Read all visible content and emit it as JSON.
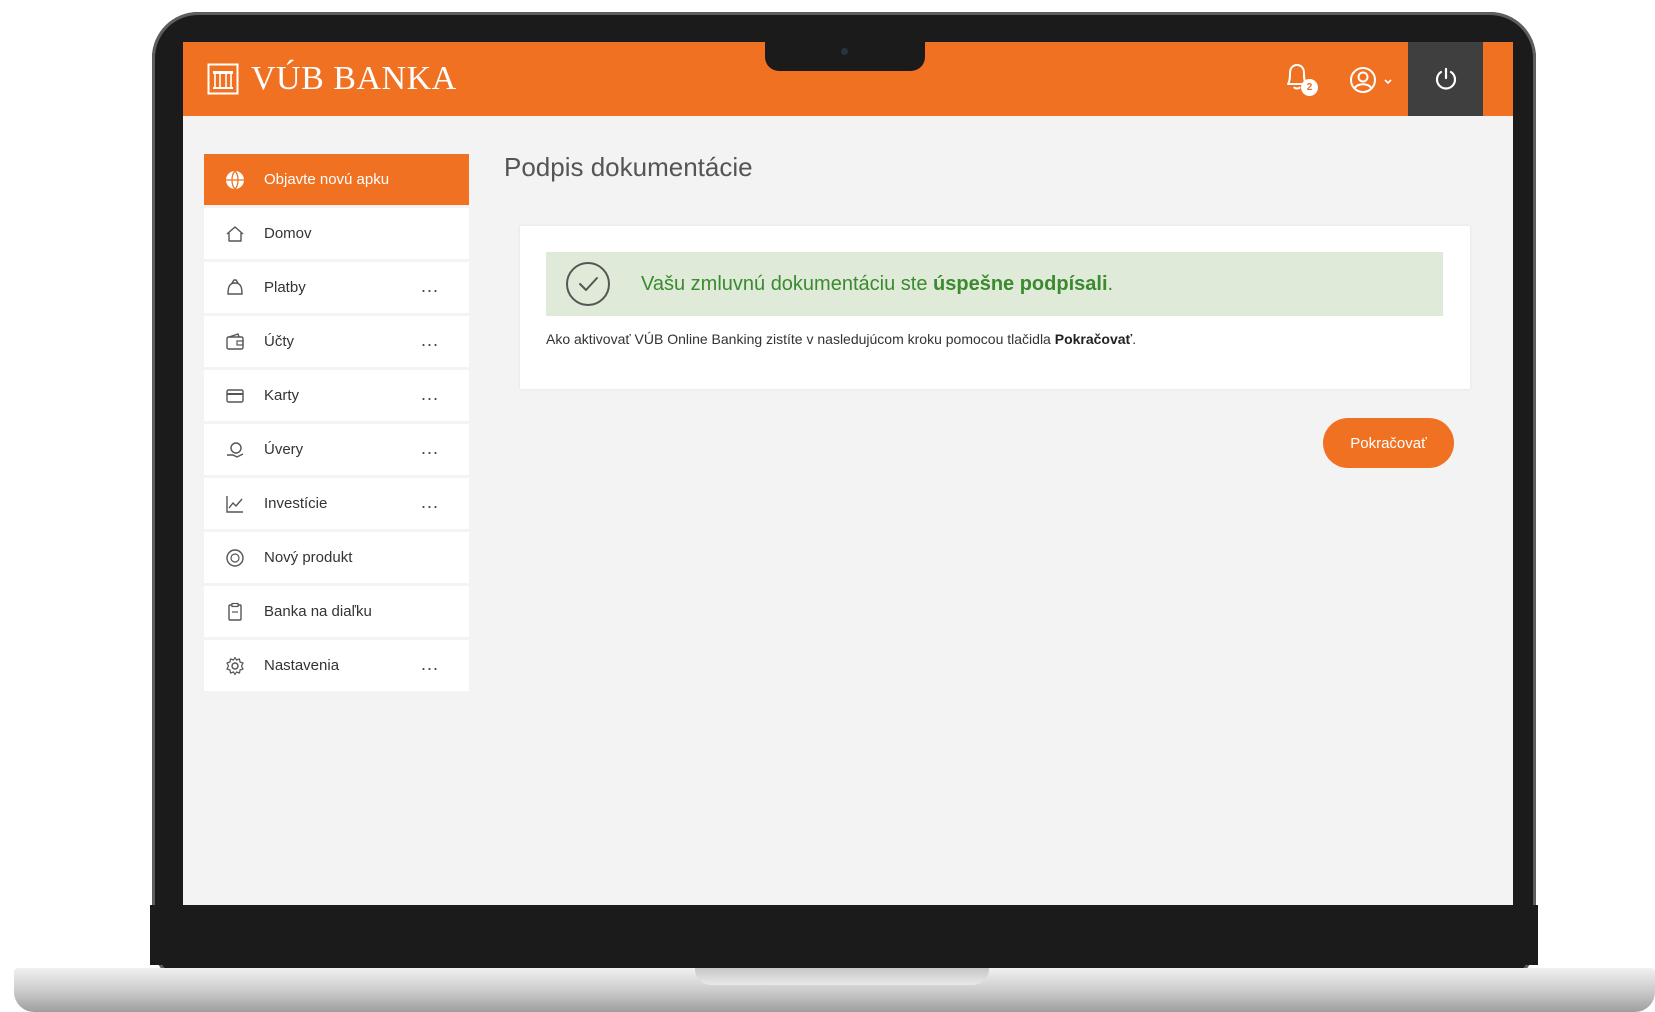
{
  "header": {
    "logo_text": "VÚB BANKA",
    "notification_count": "2",
    "brand_color": "#f07122"
  },
  "sidebar": {
    "items": [
      {
        "label": "Objavte novú apku",
        "icon": "globe-icon",
        "more": ""
      },
      {
        "label": "Domov",
        "icon": "home-icon",
        "more": ""
      },
      {
        "label": "Platby",
        "icon": "payments-icon",
        "more": "..."
      },
      {
        "label": "Účty",
        "icon": "wallet-icon",
        "more": "..."
      },
      {
        "label": "Karty",
        "icon": "card-icon",
        "more": "..."
      },
      {
        "label": "Úvery",
        "icon": "loan-icon",
        "more": "..."
      },
      {
        "label": "Investície",
        "icon": "chart-line-icon",
        "more": "..."
      },
      {
        "label": "Nový produkt",
        "icon": "new-product-icon",
        "more": ""
      },
      {
        "label": "Banka na diaľku",
        "icon": "clipboard-icon",
        "more": ""
      },
      {
        "label": "Nastavenia",
        "icon": "gear-icon",
        "more": "..."
      }
    ]
  },
  "main": {
    "title": "Podpis dokumentácie",
    "success_text_prefix": "Vašu zmluvnú dokumentáciu ste ",
    "success_text_bold": "úspešne podpísali",
    "success_text_suffix": ".",
    "info_text_prefix": "Ako aktivovať VÚB Online Banking zistíte v nasledujúcom kroku pomocou tlačidla ",
    "info_text_bold": "Pokračovať",
    "info_text_suffix": ".",
    "continue_label": "Pokračovať"
  }
}
